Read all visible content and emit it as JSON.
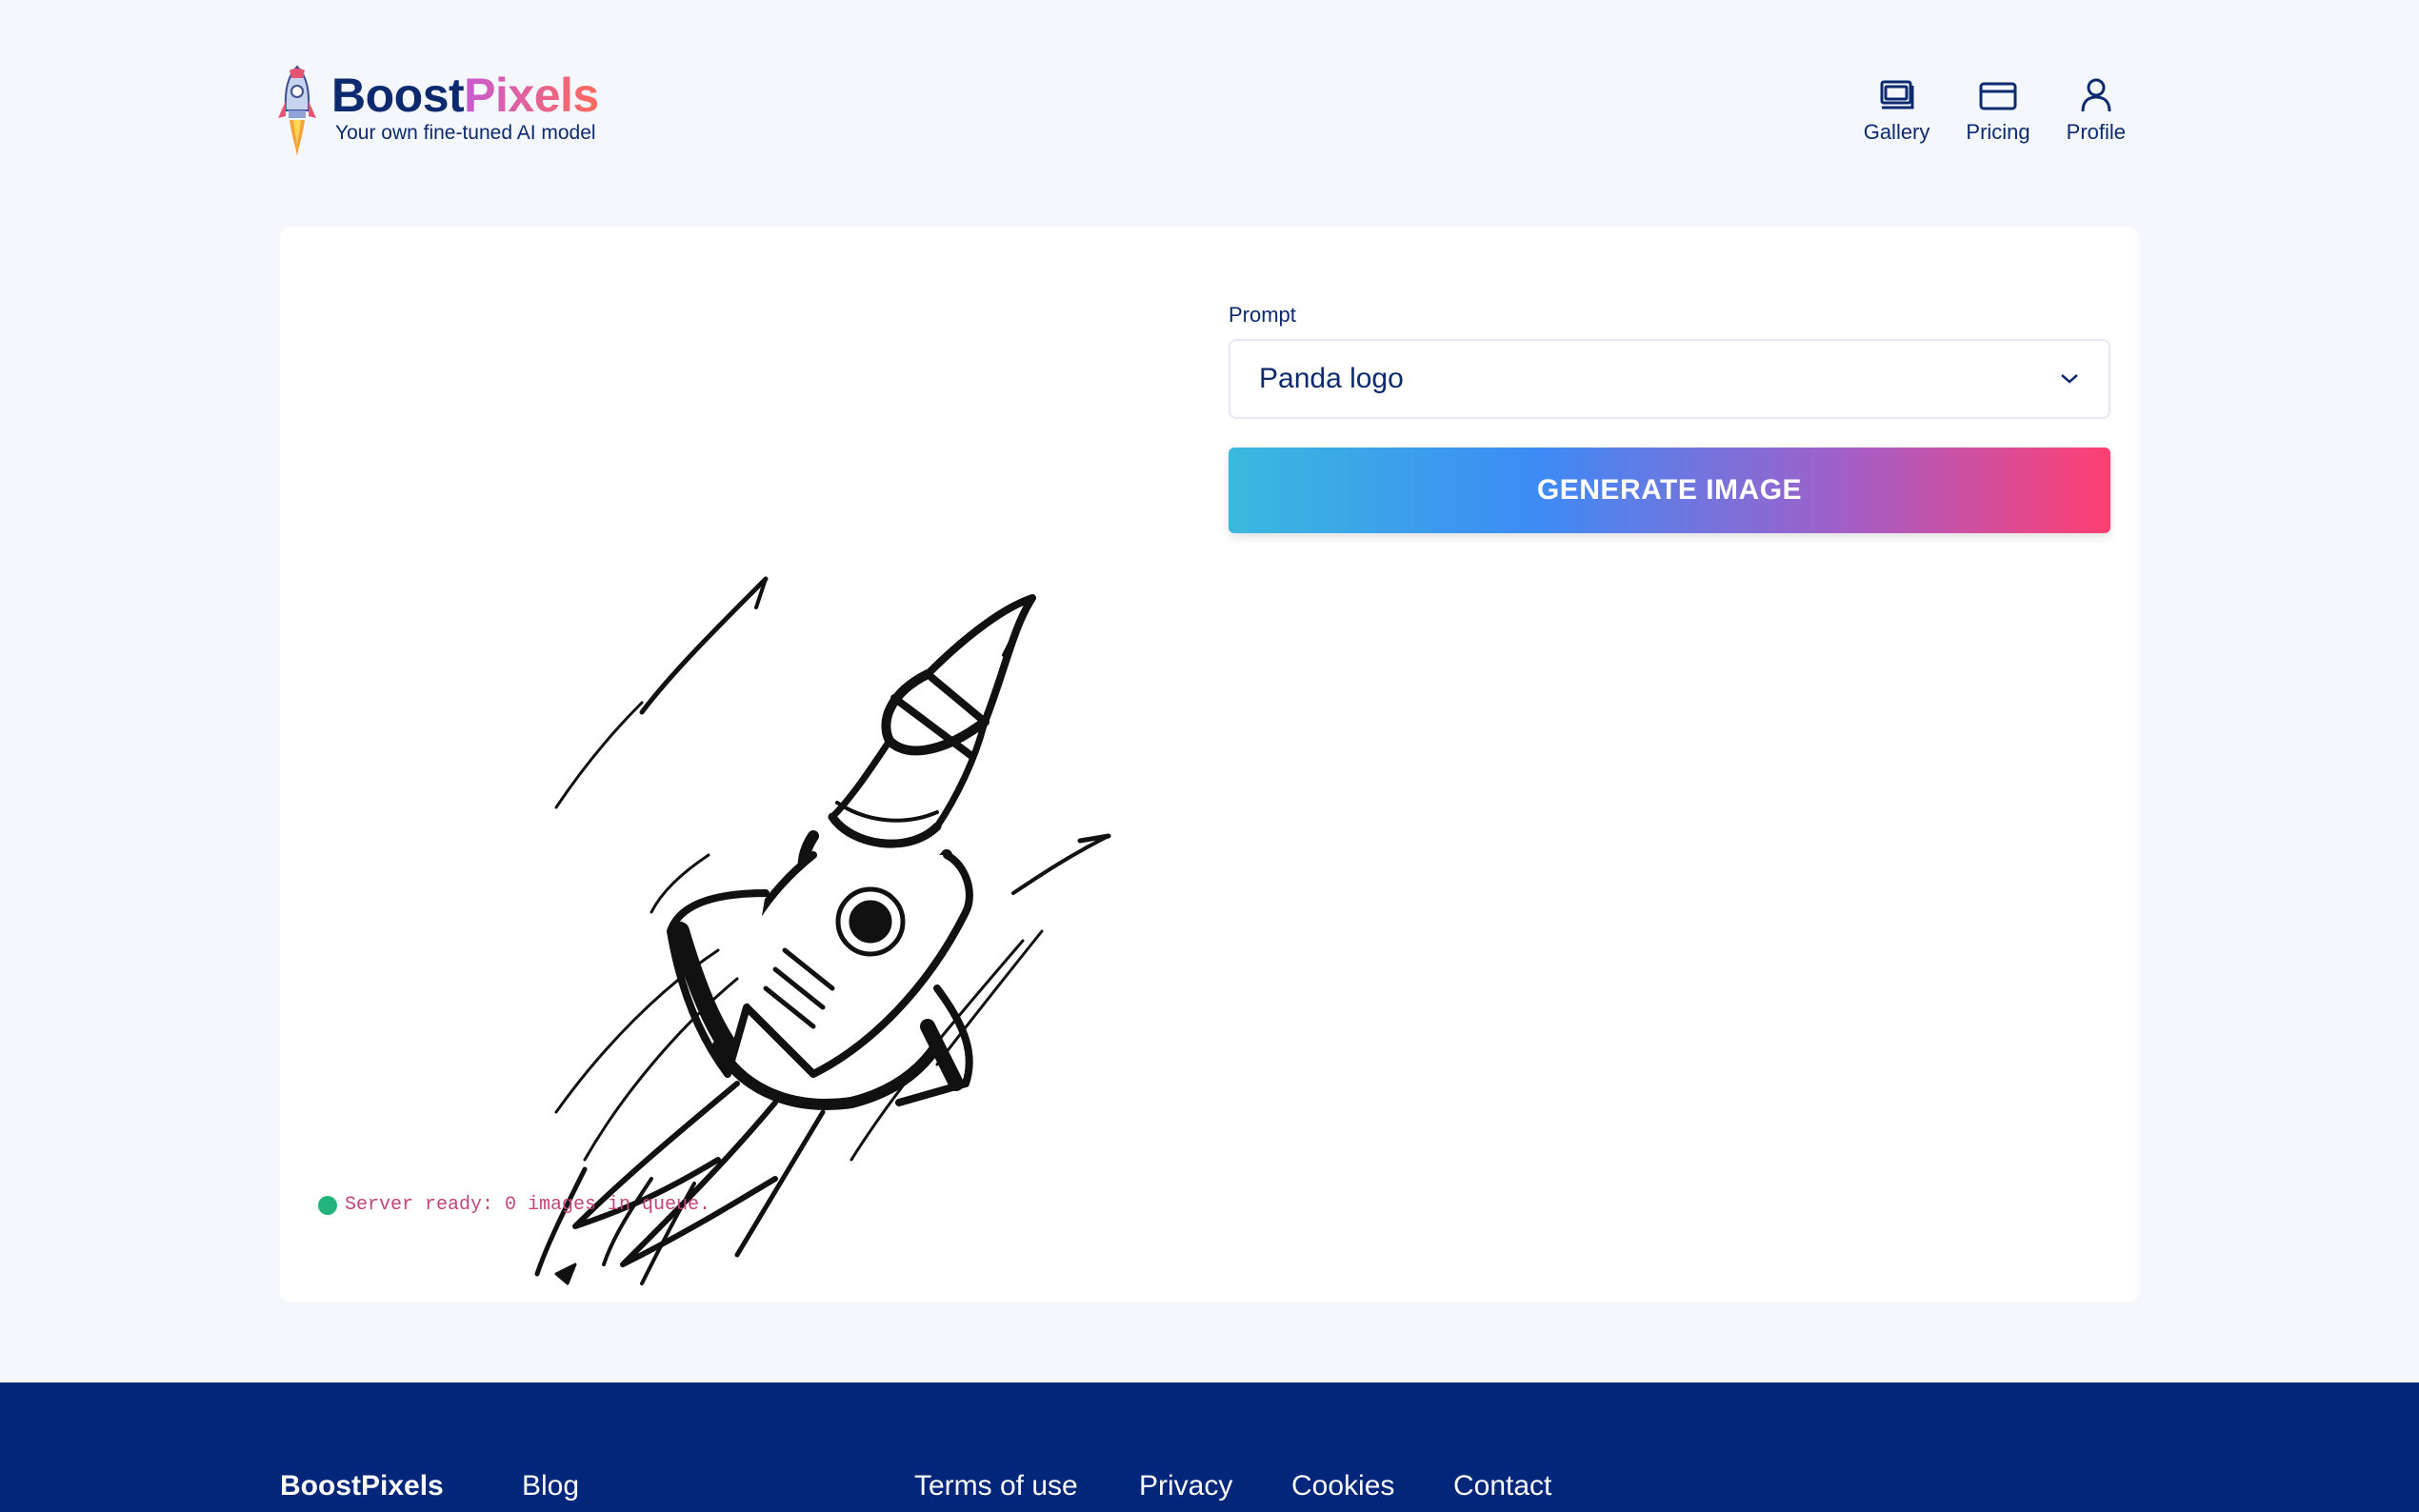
{
  "brand": {
    "name_part1": "Boost",
    "name_part2": "Pixels",
    "tagline": "Your own fine-tuned AI model",
    "colors": {
      "navy": "#0d2a6e",
      "gradient_start": "#c85bd1",
      "gradient_end": "#ff6a5c"
    }
  },
  "nav": {
    "items": [
      {
        "label": "Gallery",
        "icon": "gallery-icon"
      },
      {
        "label": "Pricing",
        "icon": "card-icon"
      },
      {
        "label": "Profile",
        "icon": "user-icon"
      }
    ]
  },
  "main": {
    "image": {
      "description_icon": "rocket-sketch"
    },
    "status": {
      "text": "Server ready: 0 images in queue.",
      "color": "#22b37a"
    },
    "prompt": {
      "label": "Prompt",
      "value": "Panda logo"
    },
    "generate_button": {
      "label": "GENERATE IMAGE"
    }
  },
  "footer": {
    "brand": "BoostPixels",
    "links": [
      "Blog",
      "Terms of use",
      "Privacy",
      "Cookies",
      "Contact"
    ],
    "background": "#02277a"
  }
}
